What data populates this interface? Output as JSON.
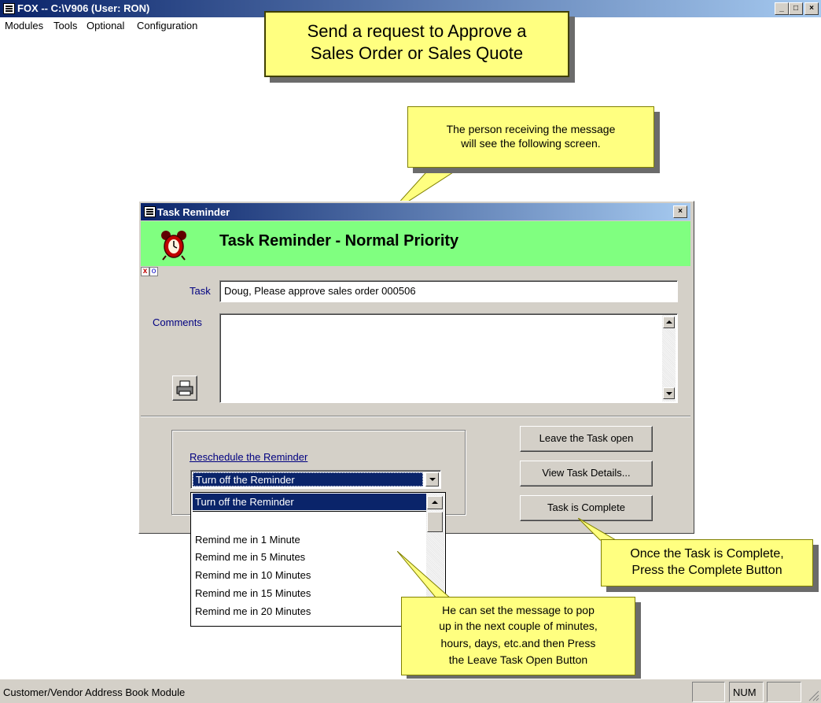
{
  "window": {
    "title": "FOX -- C:\\V906  (User: RON)",
    "buttons": {
      "minimize": "_",
      "maximize": "□",
      "close": "×"
    }
  },
  "menubar": {
    "items": [
      "Modules",
      "Tools",
      "Optional",
      "Configuration"
    ]
  },
  "callouts": {
    "top_line1": "Send a request to Approve a",
    "top_line2": "Sales Order or Sales Quote",
    "receiver_line1": "The person receiving the message",
    "receiver_line2": "will see the following screen.",
    "complete_line1": "Once the Task is Complete,",
    "complete_line2": "Press the Complete Button",
    "popup_line1": "He can set the message to pop",
    "popup_line2": "up in the next couple of minutes,",
    "popup_line3": "hours, days, etc.and then Press",
    "popup_line4": "the Leave Task Open Button"
  },
  "dialog": {
    "title": "Task Reminder",
    "close": "×",
    "heading": "Task Reminder  -  Normal Priority",
    "mini_x": "x",
    "mini_o": "o",
    "task_label": "Task",
    "task_value": "Doug, Please approve sales order 000506",
    "comments_label": "Comments",
    "comments_value": "",
    "reschedule_label": "Reschedule the Reminder",
    "reschedule_selected": "Turn off the Reminder",
    "reschedule_options": [
      "Turn off the Reminder",
      "",
      "Remind me in 1 Minute",
      "Remind me in 5 Minutes",
      "Remind me in 10 Minutes",
      "Remind me in 15 Minutes",
      "Remind me in 20 Minutes"
    ],
    "buttons": {
      "leave_open": "Leave the Task open",
      "view_details": "View Task Details...",
      "complete": "Task is Complete"
    }
  },
  "statusbar": {
    "text": "Customer/Vendor Address Book Module",
    "num": "NUM"
  },
  "colors": {
    "title_blue": "#0a246a",
    "band_green": "#80ff80",
    "callout_yellow": "#ffff80",
    "select_blue": "#0a246a"
  }
}
